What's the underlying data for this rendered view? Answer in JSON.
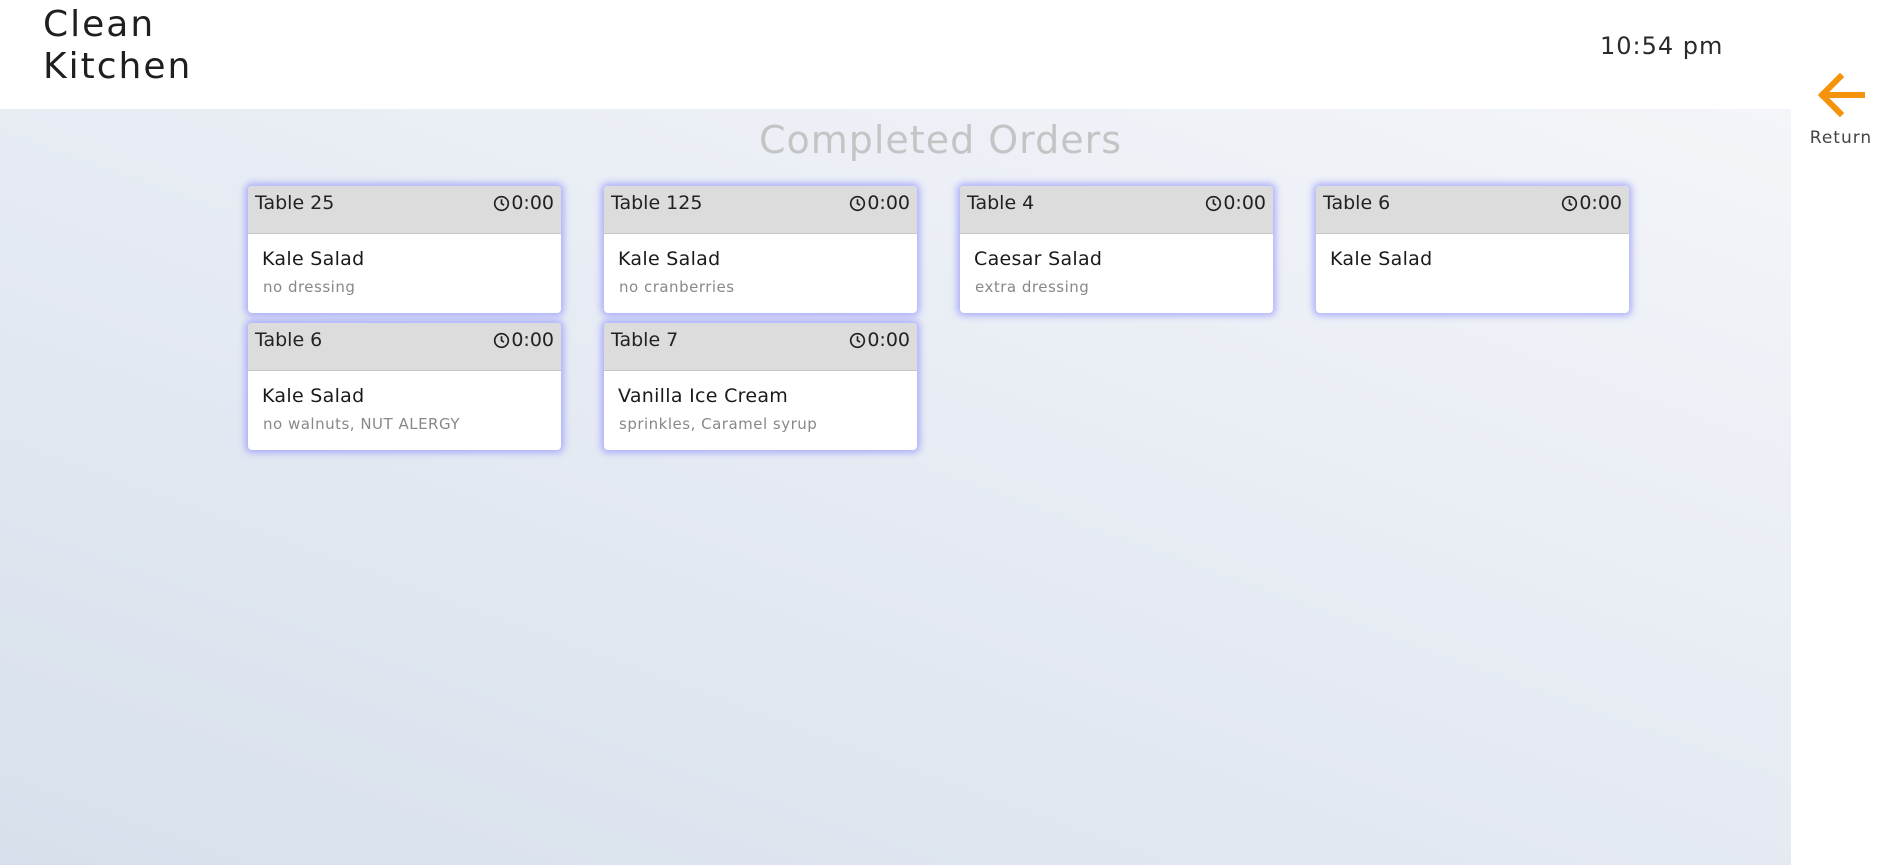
{
  "header": {
    "brand_line1": "Clean",
    "brand_line2": "Kitchen",
    "time": "10:54 pm"
  },
  "page": {
    "title": "Completed Orders"
  },
  "return_button": {
    "label": "Return",
    "icon": "arrow-left-icon",
    "color": "#f5940a"
  },
  "orders": [
    {
      "table": "Table 25",
      "timer": "0:00",
      "item": "Kale Salad",
      "note": "no dressing"
    },
    {
      "table": "Table 125",
      "timer": "0:00",
      "item": "Kale Salad",
      "note": "no cranberries"
    },
    {
      "table": "Table 4",
      "timer": "0:00",
      "item": "Caesar Salad",
      "note": "extra dressing"
    },
    {
      "table": "Table 6",
      "timer": "0:00",
      "item": "Kale Salad",
      "note": ""
    },
    {
      "table": "Table 6",
      "timer": "0:00",
      "item": "Kale Salad",
      "note": "no walnuts, NUT ALERGY"
    },
    {
      "table": "Table 7",
      "timer": "0:00",
      "item": "Vanilla Ice Cream",
      "note": "sprinkles, Caramel syrup"
    }
  ],
  "colors": {
    "card_glow": "#7d7dff",
    "accent": "#f5940a"
  }
}
